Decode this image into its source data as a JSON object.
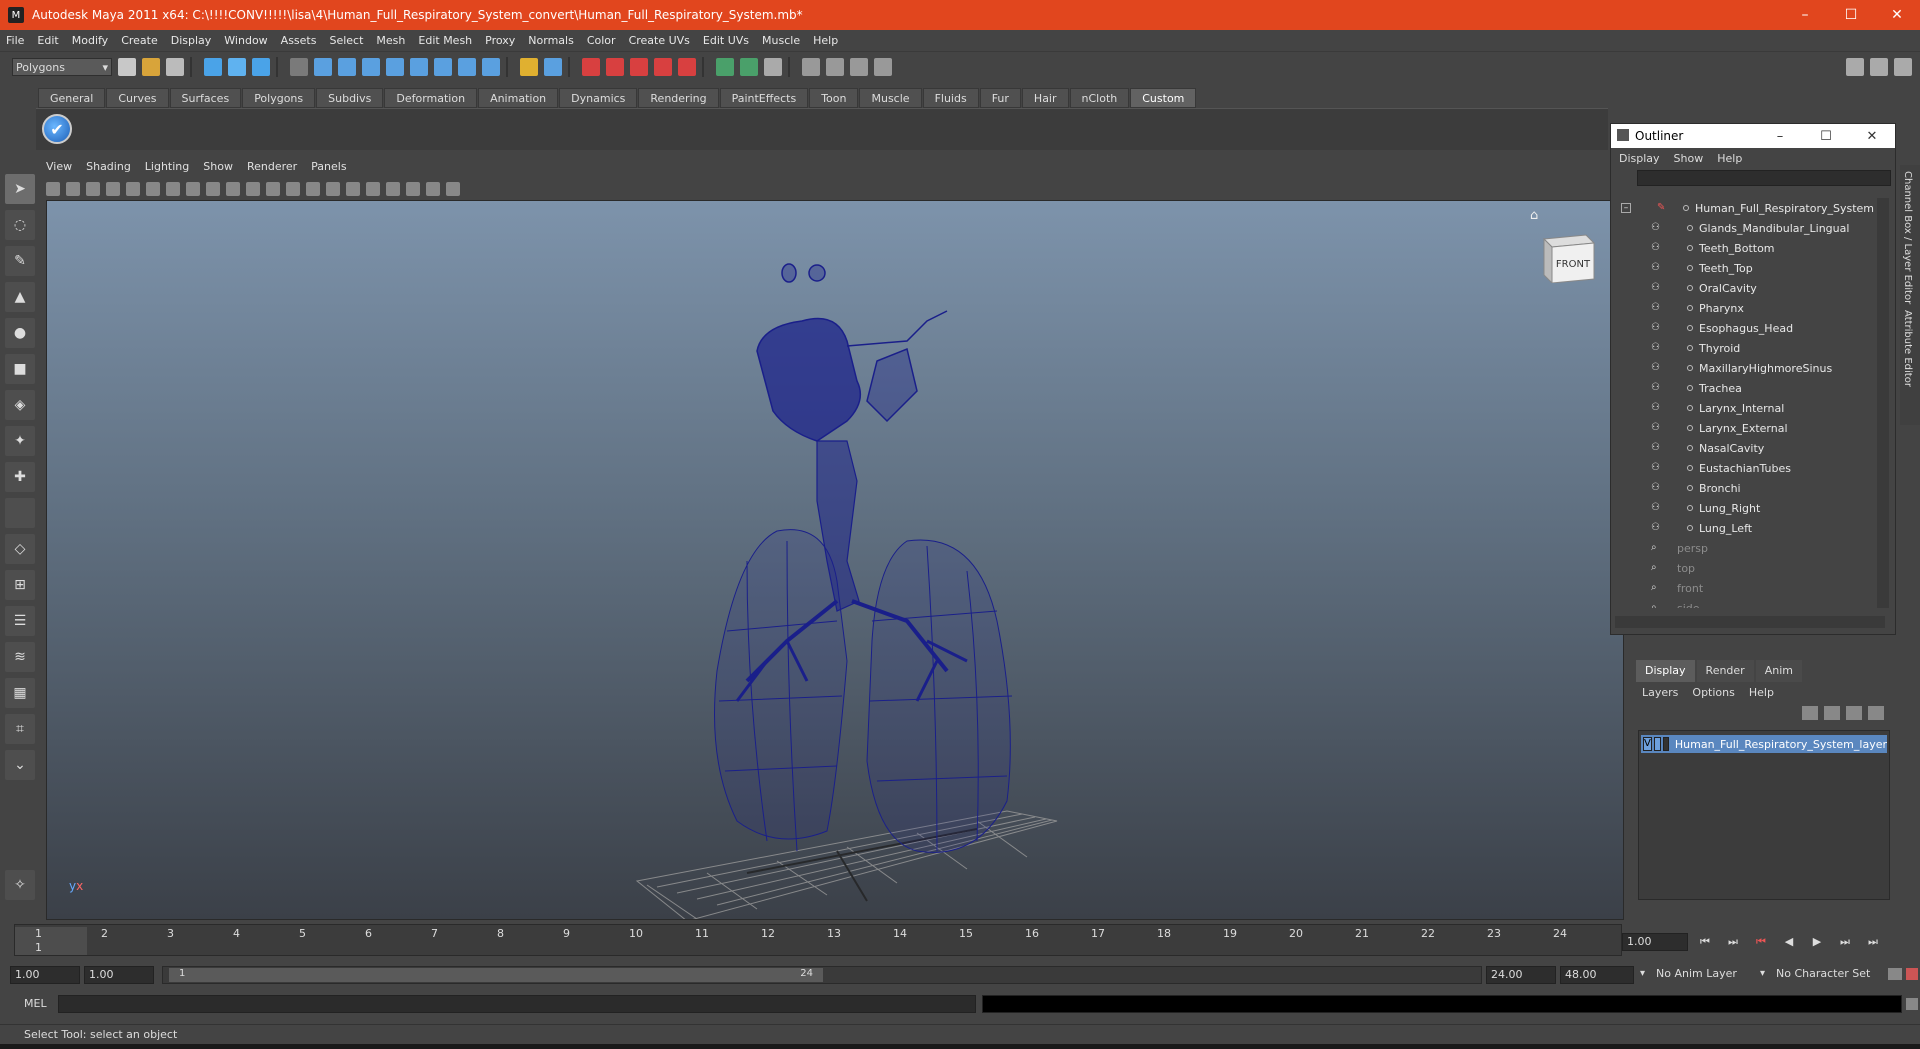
{
  "window": {
    "title": "Autodesk Maya 2011 x64: C:\\!!!!CONV!!!!!\\lisa\\4\\Human_Full_Respiratory_System_convert\\Human_Full_Respiratory_System.mb*",
    "minimize": "–",
    "maximize": "☐",
    "close": "✕"
  },
  "menubar": [
    "File",
    "Edit",
    "Modify",
    "Create",
    "Display",
    "Window",
    "Assets",
    "Select",
    "Mesh",
    "Edit Mesh",
    "Proxy",
    "Normals",
    "Color",
    "Create UVs",
    "Edit UVs",
    "Muscle",
    "Help"
  ],
  "statusline": {
    "mode": "Polygons"
  },
  "shelf_tabs": [
    "General",
    "Curves",
    "Surfaces",
    "Polygons",
    "Subdivs",
    "Deformation",
    "Animation",
    "Dynamics",
    "Rendering",
    "PaintEffects",
    "Toon",
    "Muscle",
    "Fluids",
    "Fur",
    "Hair",
    "nCloth",
    "Custom"
  ],
  "shelf_active": "Custom",
  "viewport": {
    "menus": [
      "View",
      "Shading",
      "Lighting",
      "Show",
      "Renderer",
      "Panels"
    ],
    "viewcube_label": "FRONT",
    "axis_y": "y",
    "axis_x": "x"
  },
  "outliner": {
    "title": "Outliner",
    "menus": [
      "Display",
      "Show",
      "Help"
    ],
    "root": "Human_Full_Respiratory_System",
    "children": [
      "Glands_Mandibular_Lingual",
      "Teeth_Bottom",
      "Teeth_Top",
      "OralCavity",
      "Pharynx",
      "Esophagus_Head",
      "Thyroid",
      "MaxillaryHighmoreSinus",
      "Trachea",
      "Larynx_Internal",
      "Larynx_External",
      "NasalCavity",
      "EustachianTubes",
      "Bronchi",
      "Lung_Right",
      "Lung_Left"
    ],
    "cameras": [
      "persp",
      "top",
      "front",
      "side"
    ]
  },
  "side_tabs": [
    "Channel Box / Layer Editor",
    "Attribute Editor"
  ],
  "layer_editor": {
    "tabs": [
      "Display",
      "Render",
      "Anim"
    ],
    "active_tab": "Display",
    "menus": [
      "Layers",
      "Options",
      "Help"
    ],
    "layer_visible": "V",
    "layer_name": "Human_Full_Respiratory_System_layer"
  },
  "timeslider": {
    "ticks": [
      "1",
      "2",
      "3",
      "4",
      "5",
      "6",
      "7",
      "8",
      "9",
      "10",
      "11",
      "12",
      "13",
      "14",
      "15",
      "16",
      "17",
      "18",
      "19",
      "20",
      "21",
      "22",
      "23",
      "24"
    ],
    "current_frame": "1",
    "current_time_field": "1.00"
  },
  "playback_buttons": [
    "⏮",
    "⏭",
    "⏮",
    "◀",
    "▶",
    "⏭",
    "⏭"
  ],
  "rangeslider": {
    "start_time": "1.00",
    "playback_start": "1.00",
    "range_start_label": "1",
    "range_end_label": "24",
    "playback_end": "24.00",
    "end_time": "48.00",
    "anim_layer": "No Anim Layer",
    "character_set": "No Character Set"
  },
  "cmdline": {
    "label": "MEL"
  },
  "helpline": {
    "text": "Select Tool: select an object"
  },
  "colors": {
    "titlebar": "#e1461e",
    "wireframe": "#1a1f8a",
    "layer": "#5a87bf"
  }
}
